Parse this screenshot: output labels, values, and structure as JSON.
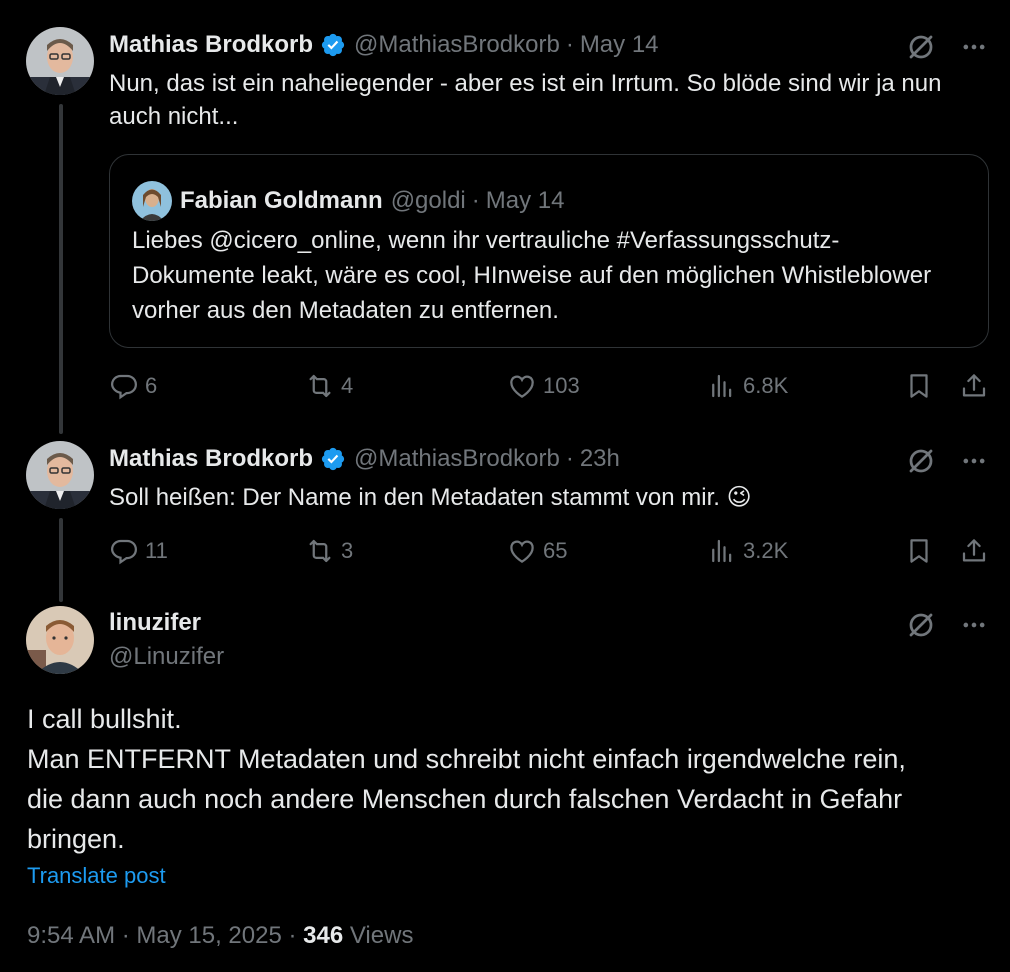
{
  "posts": [
    {
      "name": "Mathias Brodkorb",
      "handle": "@MathiasBrodkorb",
      "sep": "·",
      "time": "May 14",
      "text": "Nun, das ist ein naheliegender - aber es ist ein Irrtum. So blöde sind wir ja nun auch nicht...",
      "quote": {
        "name": "Fabian Goldmann",
        "handle": "@goldi",
        "sep": "·",
        "time": "May 14",
        "text": "Liebes @cicero_online, wenn ihr vertrauliche #Verfassungsschutz-Dokumente leakt, wäre es cool, HInweise auf den möglichen Whistleblower vorher aus den Metadaten zu entfernen."
      },
      "stats": {
        "replies": "6",
        "reposts": "4",
        "likes": "103",
        "views": "6.8K"
      }
    },
    {
      "name": "Mathias Brodkorb",
      "handle": "@MathiasBrodkorb",
      "sep": "·",
      "time": "23h",
      "text": "Soll heißen: Der Name in den Metadaten stammt von mir.",
      "emoji": "😉",
      "stats": {
        "replies": "11",
        "reposts": "3",
        "likes": "65",
        "views": "3.2K"
      }
    }
  ],
  "main_post": {
    "name": "linuzifer",
    "handle": "@Linuzifer",
    "text_lines": [
      "I call bullshit.",
      "Man ENTFERNT Metadaten und schreibt nicht einfach irgendwelche rein,",
      "die dann auch noch andere Menschen durch falschen Verdacht in Gefahr",
      "bringen."
    ],
    "translate_label": "Translate post",
    "timestamp": "9:54 AM · May 15, 2025 · ",
    "views_count": "346",
    "views_label": " Views"
  },
  "colors": {
    "background": "#000000",
    "text": "#e7e9ea",
    "muted": "#71767b",
    "accent": "#1d9bf0",
    "border": "#2f3336"
  },
  "icons": [
    "verified-badge-icon",
    "grok-icon",
    "more-icon",
    "reply-icon",
    "repost-icon",
    "like-icon",
    "views-icon",
    "bookmark-icon",
    "share-icon"
  ]
}
